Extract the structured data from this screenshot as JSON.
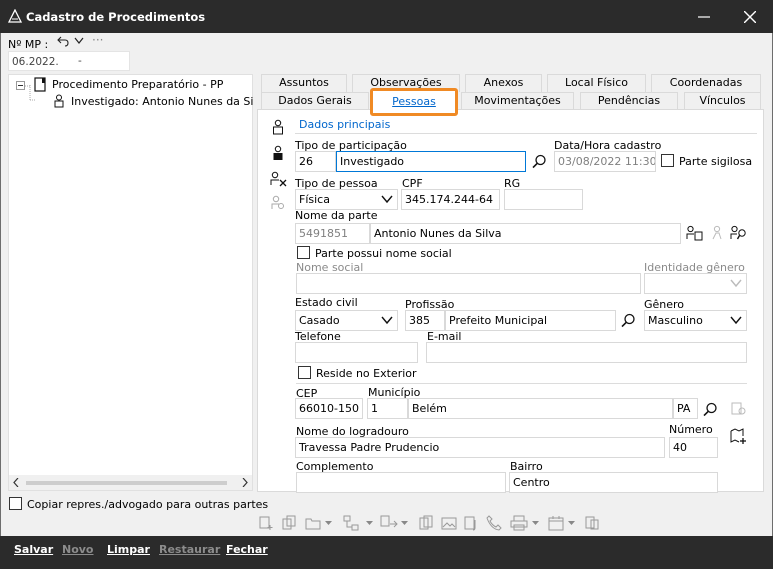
{
  "window": {
    "title": "Cadastro de Procedimentos"
  },
  "mp": {
    "label": "Nº MP :",
    "value_left": "06.2022.",
    "value_right": "-"
  },
  "tree": {
    "root": "Procedimento Preparatório - PP",
    "child": "Investigado: Antonio Nunes da Silva"
  },
  "copy_option": {
    "label": "Copiar repres./advogado para outras partes"
  },
  "tabs": {
    "row1": [
      "Assuntos",
      "Observações",
      "Anexos",
      "Local Físico",
      "Coordenadas"
    ],
    "row2": [
      "Dados Gerais",
      "Pessoas",
      "Movimentações",
      "Pendências",
      "Vínculos"
    ],
    "active": "Pessoas",
    "subtab": "Dados principais"
  },
  "form": {
    "tipo_participacao": {
      "label": "Tipo de participação",
      "code": "26",
      "value": "Investigado"
    },
    "data_hora": {
      "label": "Data/Hora cadastro",
      "value": "03/08/2022 11:30"
    },
    "parte_sigilosa": {
      "label": "Parte sigilosa"
    },
    "tipo_pessoa": {
      "label": "Tipo de pessoa",
      "value": "Física"
    },
    "cpf": {
      "label": "CPF",
      "value": "345.174.244-64"
    },
    "rg": {
      "label": "RG",
      "value": ""
    },
    "nome_parte": {
      "label": "Nome da parte",
      "code": "5491851",
      "value": "Antonio Nunes da Silva"
    },
    "nome_social_check": {
      "label": "Parte possui nome social"
    },
    "nome_social": {
      "label": "Nome social",
      "value": ""
    },
    "identidade_genero": {
      "label": "Identidade gênero",
      "value": ""
    },
    "estado_civil": {
      "label": "Estado civil",
      "value": "Casado"
    },
    "profissao": {
      "label": "Profissão",
      "code": "385",
      "value": "Prefeito Municipal"
    },
    "genero": {
      "label": "Gênero",
      "value": "Masculino"
    },
    "telefone": {
      "label": "Telefone",
      "value": ""
    },
    "email": {
      "label": "E-mail",
      "value": ""
    },
    "reside_exterior": {
      "label": "Reside no Exterior"
    },
    "cep": {
      "label": "CEP",
      "value": "66010-150"
    },
    "municipio": {
      "label": "Município",
      "code": "1",
      "value": "Belém",
      "uf": "PA"
    },
    "logradouro": {
      "label": "Nome do logradouro",
      "value": "Travessa Padre Prudencio"
    },
    "numero": {
      "label": "Número",
      "value": "40"
    },
    "complemento": {
      "label": "Complemento",
      "value": ""
    },
    "bairro": {
      "label": "Bairro",
      "value": "Centro"
    }
  },
  "buttons": {
    "salvar": "Salvar",
    "novo": "Novo",
    "limpar": "Limpar",
    "restaurar": "Restaurar",
    "fechar": "Fechar"
  },
  "colors": {
    "titlebar": "#2b2b2b",
    "accent": "#0078d7",
    "active_tab_outline": "#f08a24"
  }
}
